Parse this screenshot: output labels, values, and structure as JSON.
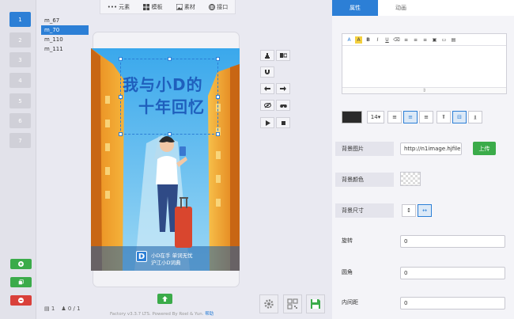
{
  "toolbar": {
    "elements": "元素",
    "template": "模板",
    "material": "素材",
    "interface": "接口"
  },
  "pages": [
    {
      "n": "1"
    },
    {
      "n": "2"
    },
    {
      "n": "3"
    },
    {
      "n": "4"
    },
    {
      "n": "5"
    },
    {
      "n": "6"
    },
    {
      "n": "7"
    }
  ],
  "layers": [
    {
      "name": "m_67"
    },
    {
      "name": "m_70"
    },
    {
      "name": "m_110"
    },
    {
      "name": "m_111"
    }
  ],
  "canvas": {
    "title_line1": "我与小D的",
    "title_line2": "十年回忆",
    "brand_line1": "小D在手 单词无忧",
    "brand_line2": "沪江小D词典",
    "brand_logo": "D"
  },
  "stats": {
    "pages": "1",
    "users": "0 / 1"
  },
  "footer": {
    "text": "Factory v3.3.7 LTS. Powered By Roel & Yun.",
    "help": "帮助"
  },
  "panel": {
    "tabs": {
      "properties": "属性",
      "animation": "动画"
    },
    "font_size": "14",
    "bg_image_label": "背景图片",
    "bg_image_url": "http://n1image.hjfile",
    "upload": "上传",
    "bg_color_label": "背景颜色",
    "bg_size_label": "背景尺寸",
    "rotate_label": "旋转",
    "rotate_value": "0",
    "radius_label": "圆角",
    "radius_value": "0",
    "padding_label": "内间距",
    "padding_value": "0"
  },
  "colors": {
    "accent": "#2c7fd6",
    "green": "#3bab4a",
    "red": "#d9403a"
  }
}
